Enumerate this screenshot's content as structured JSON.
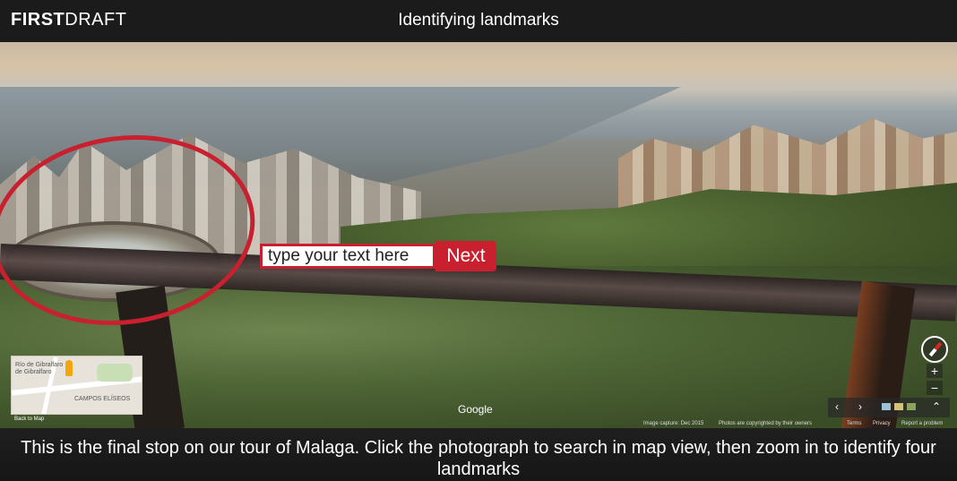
{
  "header": {
    "logo_bold": "FIRST",
    "logo_light": "DRAFT",
    "title": "Identifying landmarks"
  },
  "scene": {
    "input_placeholder": "type your text here",
    "next_label": "Next",
    "minimap": {
      "label_1": "Río de Gibralfaro",
      "label_2": "de Gibralfaro",
      "label_3": "CAMPOS ELÍSEOS",
      "back_label": "Back to Map"
    },
    "google_label": "Google",
    "fineprint": {
      "capture": "Image capture: Dec 2015",
      "copyright": "Photos are copyrighted by their owners",
      "terms": "Terms",
      "privacy": "Privacy",
      "report": "Report a problem"
    },
    "controls": {
      "zoom_in": "+",
      "zoom_out": "−",
      "prev": "‹",
      "next": "›",
      "expand": "⌃"
    }
  },
  "footer": {
    "instructions": "This is the final stop on our tour of Malaga. Click the photograph to search in map view, then zoom in to identify four landmarks"
  },
  "colors": {
    "accent": "#c8202f",
    "header_bg": "#1b1b1b"
  },
  "icons": [
    "compass-icon",
    "pegman-icon",
    "chevron-left-icon",
    "chevron-right-icon",
    "expand-icon"
  ]
}
